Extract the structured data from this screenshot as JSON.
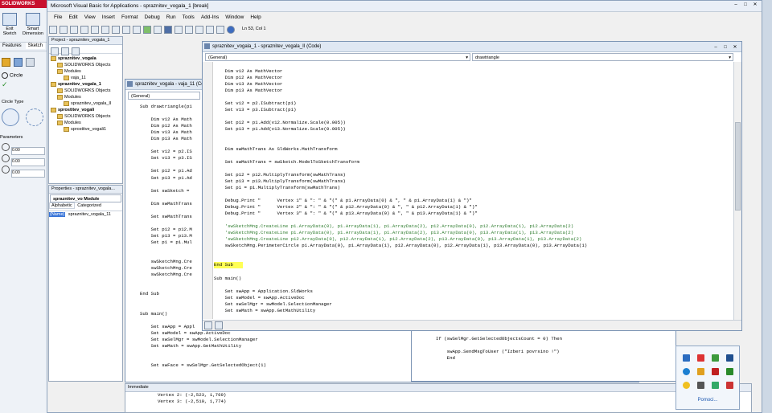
{
  "solidworks": {
    "logo": "SOLIDWORKS",
    "exit_sketch": "Exit Sketch",
    "smart_dimension": "Smart Dimension",
    "tabs": [
      "Features",
      "Sketch"
    ],
    "circle_label": "Circle",
    "circle_type_label": "Circle Type",
    "parameters_label": "Parameters",
    "param_values": [
      "0.00",
      "0.00",
      "0.00"
    ]
  },
  "vbe": {
    "title": "Microsoft Visual Basic for Applications - spraznitev_vogala_1 [break]",
    "menu": [
      "File",
      "Edit",
      "View",
      "Insert",
      "Format",
      "Debug",
      "Run",
      "Tools",
      "Add-Ins",
      "Window",
      "Help"
    ],
    "cursor_pos": "Ln 53, Col 1"
  },
  "project": {
    "title": "Project - spraznitev_vogala_1",
    "items": [
      {
        "label": "spraznitev_vogala",
        "level": 1,
        "bold": true
      },
      {
        "label": "SOLIDWORKS Objects",
        "level": 2
      },
      {
        "label": "Modules",
        "level": 2
      },
      {
        "label": "vaja_11",
        "level": 3
      },
      {
        "label": "spraznitev_vogala_1",
        "level": 1,
        "bold": true
      },
      {
        "label": "SOLIDWORKS Objects",
        "level": 2
      },
      {
        "label": "Modules",
        "level": 2
      },
      {
        "label": "spraznitev_vogala_II",
        "level": 3
      },
      {
        "label": "sprostitev_vogali",
        "level": 1,
        "bold": true
      },
      {
        "label": "SOLIDWORKS Objects",
        "level": 2
      },
      {
        "label": "Modules",
        "level": 2
      },
      {
        "label": "sprostitve_vogali1",
        "level": 3
      }
    ]
  },
  "properties": {
    "title": "Properties - spraznitev_vogala...",
    "object": "spraznitev_vo Module",
    "tabs": [
      "Alphabetic",
      "Categorized"
    ],
    "name_key": "(Name)",
    "name_value": "spraznitev_vogala_11"
  },
  "win_back": {
    "title": "spraznitev_vogala - vaja_11 (Code)",
    "dropdown": "(General)",
    "lines": [
      "Sub drawtriangle(p1",
      "",
      "    Dim v12 As Math",
      "    Dim p12 As Math",
      "    Dim v13 As Math",
      "    Dim p13 As Math",
      "",
      "    Set v12 = p2.IS",
      "    Set v13 = p3.IS",
      "",
      "    Set p12 = p1.Ad",
      "    Set p13 = p1.Ad",
      "",
      "    Set swSketch =",
      "",
      "    Dim swMathTrans",
      "",
      "    Set swMathTrans",
      "",
      "    Set p12 = p12.M",
      "    Set p13 = p13.M",
      "    Set p1 = p1.Mul",
      "",
      "",
      "    swSketchMng.Cre",
      "    swSketchMng.Cre",
      "    swSketchMng.Cre",
      "",
      "",
      "End Sub",
      "",
      "",
      "Sub main()",
      "",
      "    Set swApp = Appl",
      "    Set swModel = swApp.ActiveDoc",
      "    Set swSelMgr = swModel.SelectionManager",
      "    Set swMath = swApp.GetMathUtility",
      "",
      "",
      "    Set swFace = swSelMgr.GetSelectedObject(1)"
    ]
  },
  "win_front": {
    "title": "spraznitev_vogala_1 - spraznitev_vogala_II (Code)",
    "dropdown_left": "(General)",
    "dropdown_right": "drawtriangle",
    "lines": [
      {
        "t": "    Dim v12 As MathVector"
      },
      {
        "t": "    Dim p12 As MathVector"
      },
      {
        "t": "    Dim v13 As MathVector"
      },
      {
        "t": "    Dim p13 As MathVector"
      },
      {
        "t": ""
      },
      {
        "t": "    Set v12 = p2.ISubtract(p1)"
      },
      {
        "t": "    Set v13 = p3.ISubtract(p1)"
      },
      {
        "t": ""
      },
      {
        "t": "    Set p12 = p1.Add(v12.Normalize.Scale(0.005))"
      },
      {
        "t": "    Set p13 = p1.Add(v13.Normalize.Scale(0.005))"
      },
      {
        "t": ""
      },
      {
        "t": ""
      },
      {
        "t": "    Dim swMathTrans As SldWorks.MathTransform"
      },
      {
        "t": ""
      },
      {
        "t": "    Set swMathTrans = swSketch.ModelToSketchTransform"
      },
      {
        "t": ""
      },
      {
        "t": "    Set p12 = p12.MultiplyTransform(swMathTrans)"
      },
      {
        "t": "    Set p13 = p13.MultiplyTransform(swMathTrans)"
      },
      {
        "t": "    Set p1 = p1.MultiplyTransform(swMathTrans)"
      },
      {
        "t": ""
      },
      {
        "t": "    Debug.Print \"      Vertex 1\" & \": \" & \"(\" & p1.ArrayData(0) & \", \" & p1.ArrayData(1) & \")\""
      },
      {
        "t": "    Debug.Print \"      Vertex 2\" & \": \" & \"(\" & p12.ArrayData(0) & \", \" & p12.ArrayData(1) & \")\""
      },
      {
        "t": "    Debug.Print \"      Vertex 3\" & \": \" & \"(\" & p13.ArrayData(0) & \", \" & p13.ArrayData(1) & \")\""
      },
      {
        "t": ""
      },
      {
        "t": "    'swSketchMng.CreateLine p1.ArrayData(0), p1.ArrayData(1), p1.ArrayData(2), p12.ArrayData(0), p12.ArrayData(1), p12.ArrayData(2)",
        "c": "green"
      },
      {
        "t": "    'swSketchMng.CreateLine p1.ArrayData(0), p1.ArrayData(1), p1.ArrayData(2), p13.ArrayData(0), p13.ArrayData(1), p13.ArrayData(2)",
        "c": "green"
      },
      {
        "t": "    'swSketchMng.CreateLine p12.ArrayData(0), p12.ArrayData(1), p12.ArrayData(2), p13.ArrayData(0), p13.ArrayData(1), p13.ArrayData(2)",
        "c": "green"
      },
      {
        "t": "    swSketchMng.PerimeterCircle p1.ArrayData(0), p1.ArrayData(1), p12.ArrayData(0), p12.ArrayData(1), p13.ArrayData(0), p13.ArrayData(1)"
      },
      {
        "t": ""
      },
      {
        "t": ""
      },
      {
        "t": "End Sub",
        "hl": true
      },
      {
        "t": ""
      },
      {
        "t": "Sub main()"
      },
      {
        "t": ""
      },
      {
        "t": "    Set swApp = Application.SldWorks"
      },
      {
        "t": "    Set swModel = swApp.ActiveDoc"
      },
      {
        "t": "    Set swSelMgr = swModel.SelectionManager"
      },
      {
        "t": "    Set swMath = swApp.GetMathUtility"
      }
    ]
  },
  "win_right": {
    "lines": [
      "If (swSelMgr.GetSelectedObjectsCount = 0) Then",
      "",
      "    swApp.SendMsgToUser (\"Izberi povrsino !\")",
      "    End"
    ]
  },
  "immediate": {
    "title": "Immediate",
    "lines": [
      "Vertex 2: (-2,523, 1,769)",
      "Vertex 3: (-2,510, 1,774)"
    ]
  },
  "notification": {
    "link": "Pomoci..."
  }
}
